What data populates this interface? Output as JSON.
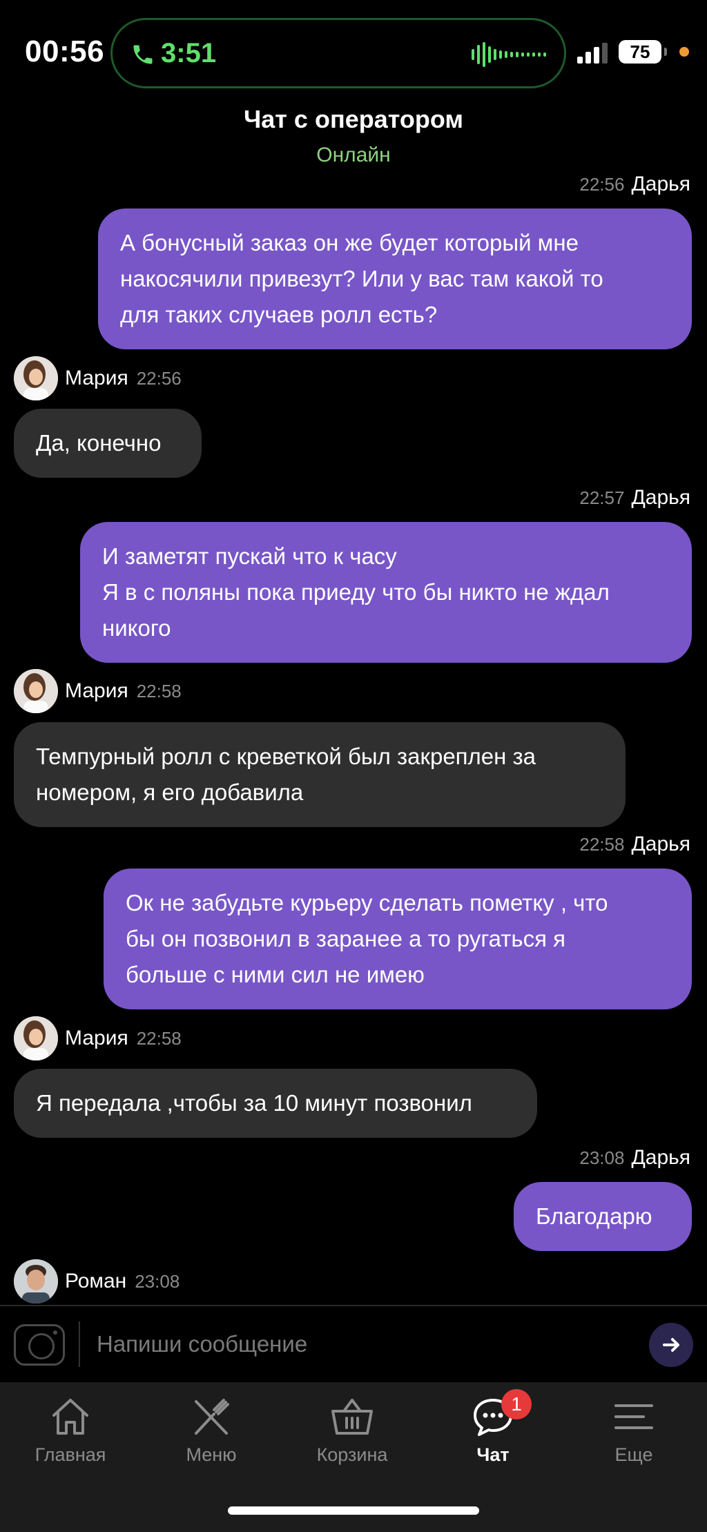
{
  "status_bar": {
    "time": "00:56",
    "call_duration": "3:51",
    "battery": "75"
  },
  "header": {
    "title": "Чат с оператором",
    "status": "Онлайн"
  },
  "messages": [
    {
      "direction": "out",
      "author": "Дарья",
      "time": "22:56",
      "lines": [
        "А бонусный заказ он же будет который мне",
        "накосячили привезут? Или у вас там какой то",
        "для таких случаев ролл есть?"
      ]
    },
    {
      "direction": "in",
      "author": "Мария",
      "time": "22:56",
      "lines": [
        "Да, конечно"
      ]
    },
    {
      "direction": "out",
      "author": "Дарья",
      "time": "22:57",
      "lines": [
        "И заметят пускай что к часу",
        "Я в с поляны пока приеду что бы никто не ждал",
        "никого"
      ]
    },
    {
      "direction": "in",
      "author": "Мария",
      "time": "22:58",
      "lines": [
        "Темпурный ролл с креветкой был закреплен за",
        "номером, я его добавила"
      ]
    },
    {
      "direction": "out",
      "author": "Дарья",
      "time": "22:58",
      "lines": [
        "Ок не забудьте курьеру сделать пометку , что",
        "бы он позвонил в заранее а то ругаться я",
        "больше с ними сил не имею"
      ]
    },
    {
      "direction": "in",
      "author": "Мария",
      "time": "22:58",
      "lines": [
        "Я передала ,чтобы за 10 минут позвонил"
      ]
    },
    {
      "direction": "out",
      "author": "Дарья",
      "time": "23:08",
      "lines": [
        "Благодарю"
      ]
    },
    {
      "direction": "in",
      "author": "Роман",
      "time": "23:08",
      "lines": []
    }
  ],
  "input": {
    "placeholder": "Напиши сообщение"
  },
  "tabs": [
    {
      "label": "Главная",
      "icon": "home-icon",
      "active": false
    },
    {
      "label": "Меню",
      "icon": "fork-knife-icon",
      "active": false
    },
    {
      "label": "Корзина",
      "icon": "basket-icon",
      "active": false
    },
    {
      "label": "Чат",
      "icon": "chat-bubble-icon",
      "active": true,
      "badge": "1"
    },
    {
      "label": "Еще",
      "icon": "hamburger-icon",
      "active": false
    }
  ],
  "colors": {
    "outgoing_bubble": "#7856c8",
    "incoming_bubble": "#2f2f2f",
    "online_status": "#8ed37e",
    "call_green": "#5fe06c",
    "badge_red": "#e5393a"
  }
}
